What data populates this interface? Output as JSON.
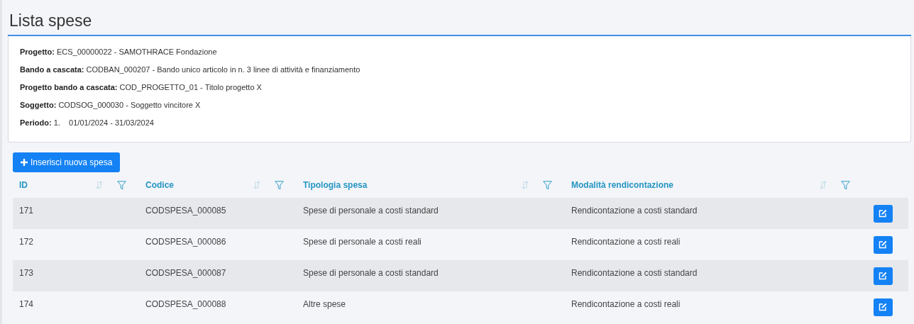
{
  "page": {
    "title": "Lista spese"
  },
  "info": [
    {
      "label": "Progetto:",
      "value": "ECS_00000022 - SAMOTHRACE Fondazione"
    },
    {
      "label": "Bando a cascata:",
      "value": "CODBAN_000207 - Bando unico articolo in n. 3 linee di attività e finanziamento"
    },
    {
      "label": "Progetto bando a cascata:",
      "value": "COD_PROGETTO_01 - Titolo progetto X"
    },
    {
      "label": "Soggetto:",
      "value": "CODSOG_000030 - Soggetto vincitore X"
    },
    {
      "label": "Periodo:",
      "value": "1.    01/01/2024 - 31/03/2024"
    }
  ],
  "add_button": {
    "label": "Inserisci nuova spesa"
  },
  "table": {
    "columns": [
      "ID",
      "Codice",
      "Tipologia spesa",
      "Modalità rendicontazione"
    ],
    "rows": [
      {
        "cells": [
          "171",
          "CODSPESA_000085",
          "Spese di personale a costi standard",
          "Rendicontazione a costi standard"
        ]
      },
      {
        "cells": [
          "172",
          "CODSPESA_000086",
          "Spese di personale a costi reali",
          "Rendicontazione a costi reali"
        ]
      },
      {
        "cells": [
          "173",
          "CODSPESA_000087",
          "Spese di personale a costi standard",
          "Rendicontazione a costi standard"
        ]
      },
      {
        "cells": [
          "174",
          "CODSPESA_000088",
          "Altre spese",
          "Rendicontazione a costi reali"
        ]
      }
    ]
  }
}
